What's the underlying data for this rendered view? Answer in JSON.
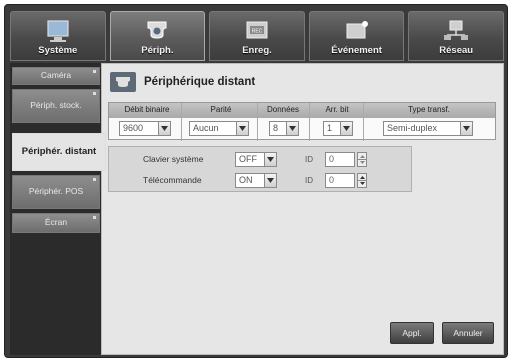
{
  "top_tabs": [
    {
      "label": "Système",
      "icon": "system-icon"
    },
    {
      "label": "Périph.",
      "icon": "device-icon"
    },
    {
      "label": "Enreg.",
      "icon": "record-icon"
    },
    {
      "label": "Événement",
      "icon": "event-icon"
    },
    {
      "label": "Réseau",
      "icon": "network-icon"
    }
  ],
  "sidebar": {
    "items": [
      {
        "label": "Caméra"
      },
      {
        "label": "Périph. stock."
      },
      {
        "label": "Périphér. distant"
      },
      {
        "label": "Périphér. POS"
      },
      {
        "label": "Écran"
      }
    ]
  },
  "content": {
    "title": "Périphérique distant",
    "serial": {
      "headers": [
        "Débit binaire",
        "Parité",
        "Données",
        "Arr. bit",
        "Type transf."
      ],
      "values": [
        "9600",
        "Aucun",
        "8",
        "1",
        "Semi-duplex"
      ]
    },
    "controls": [
      {
        "label": "Clavier système",
        "value": "OFF",
        "id_label": "ID",
        "id_value": "0"
      },
      {
        "label": "Télécommande",
        "value": "ON",
        "id_label": "ID",
        "id_value": "0"
      }
    ],
    "apply_label": "Appl.",
    "cancel_label": "Annuler"
  }
}
